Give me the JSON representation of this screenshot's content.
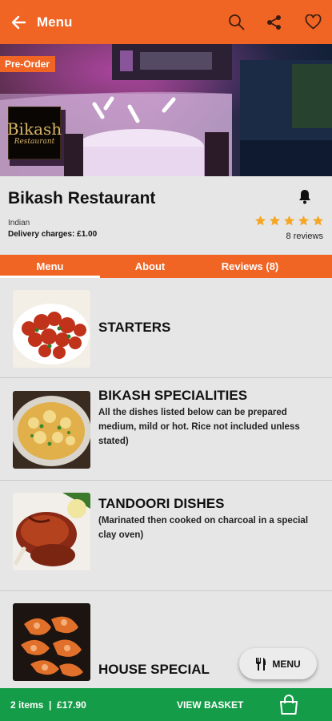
{
  "header": {
    "title": "Menu"
  },
  "hero": {
    "badge": "Pre-Order",
    "logo_line1": "Bikash",
    "logo_line2": "Restaurant"
  },
  "restaurant": {
    "name": "Bikash Restaurant",
    "cuisine": "Indian",
    "delivery": "Delivery charges: £1.00",
    "rating": 5,
    "reviews": "8 reviews"
  },
  "tabs": [
    {
      "label": "Menu"
    },
    {
      "label": "About"
    },
    {
      "label": "Reviews (8)"
    }
  ],
  "categories": [
    {
      "title": "STARTERS",
      "desc": ""
    },
    {
      "title": "BIKASH SPECIALITIES",
      "desc": "All the dishes listed below can be prepared medium, mild or hot. Rice not included unless stated)"
    },
    {
      "title": "TANDOORI DISHES",
      "desc": "(Marinated then cooked on charcoal in a special clay oven)"
    },
    {
      "title": "HOUSE SPECIAL",
      "desc": ""
    }
  ],
  "fab": {
    "label": "MENU"
  },
  "basket": {
    "summary": "2 items  |  £17.90",
    "action": "VIEW BASKET"
  },
  "colors": {
    "brand": "#f06424",
    "basket": "#149c48",
    "star": "#f5a623"
  }
}
